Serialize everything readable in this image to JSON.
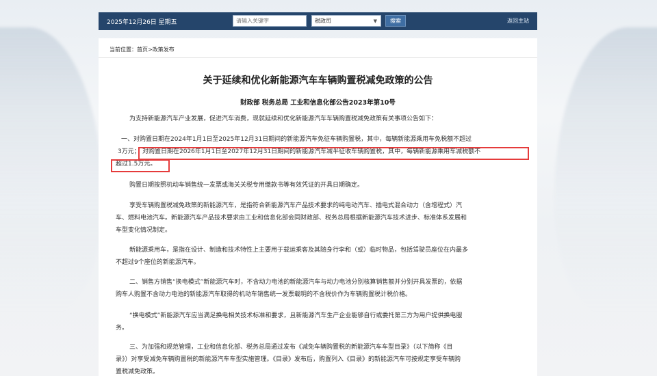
{
  "header": {
    "date": "2025年12月26日 星期五",
    "search_placeholder": "请输入关键字",
    "category_selected": "税政司",
    "search_button": "搜索",
    "home_link": "返回主站"
  },
  "breadcrumb": "当前位置：首页>政策发布",
  "article": {
    "title": "关于延续和优化新能源汽车车辆购置税减免政策的公告",
    "subtitle": "财政部 税务总局 工业和信息化部公告2023年第10号",
    "p0": "为支持新能源汽车产业发展，促进汽车消费，现就延续和优化新能源汽车车辆购置税减免政策有关事项公告如下：",
    "p1a": "一、对购置日期在2024年1月1日至2025年12月31日期间的新能源汽车免征车辆购置税，其中，每辆新能源乘用车免税额不超过",
    "p1b": "3万元；",
    "p1c": "对购置日期在2026年1月1日至2027年12月31日期间的新能源汽车减半征收车辆购置税，其中，每辆新能源乘用车减税额不",
    "p1d": "超过1.5万元。",
    "p2": "购置日期按照机动车销售统一发票或海关关税专用缴款书等有效凭证的开具日期确定。",
    "p3a": "享受车辆购置税减免政策的新能源汽车，是指符合新能源汽车产品技术要求的纯电动汽车、插电式混合动力（含增程式）汽",
    "p3b": "车、燃料电池汽车。新能源汽车产品技术要求由工业和信息化部会同财政部、税务总局根据新能源汽车技术进步、标准体系发展和",
    "p3c": "车型变化情况制定。",
    "p4a": "新能源乘用车，是指在设计、制造和技术特性上主要用于载运乘客及其随身行李和（或）临时物品，包括驾驶员座位在内最多",
    "p4b": "不超过9个座位的新能源汽车。",
    "p5a": "二、销售方销售“换电模式”新能源汽车时，不含动力电池的新能源汽车与动力电池分别核算销售额并分别开具发票的，依据",
    "p5b": "购车人购置不含动力电池的新能源汽车取得的机动车销售统一发票载明的不含税价作为车辆购置税计税价格。",
    "p6a": "“换电模式”新能源汽车应当满足换电相关技术标准和要求，且新能源汽车生产企业能够自行或委托第三方为用户提供换电服",
    "p6b": "务。",
    "p7a": "三、为加强和规范管理，工业和信息化部、税务总局通过发布《减免车辆购置税的新能源汽车车型目录》（以下简称《目",
    "p7b": "录》）对享受减免车辆购置税的新能源汽车车型实施管理。《目录》发布后，购置列入《目录》的新能源汽车可按规定享受车辆购",
    "p7c": "置税减免政策。"
  },
  "colors": {
    "header_bg": "#25456b",
    "highlight": "#e53b3b"
  }
}
